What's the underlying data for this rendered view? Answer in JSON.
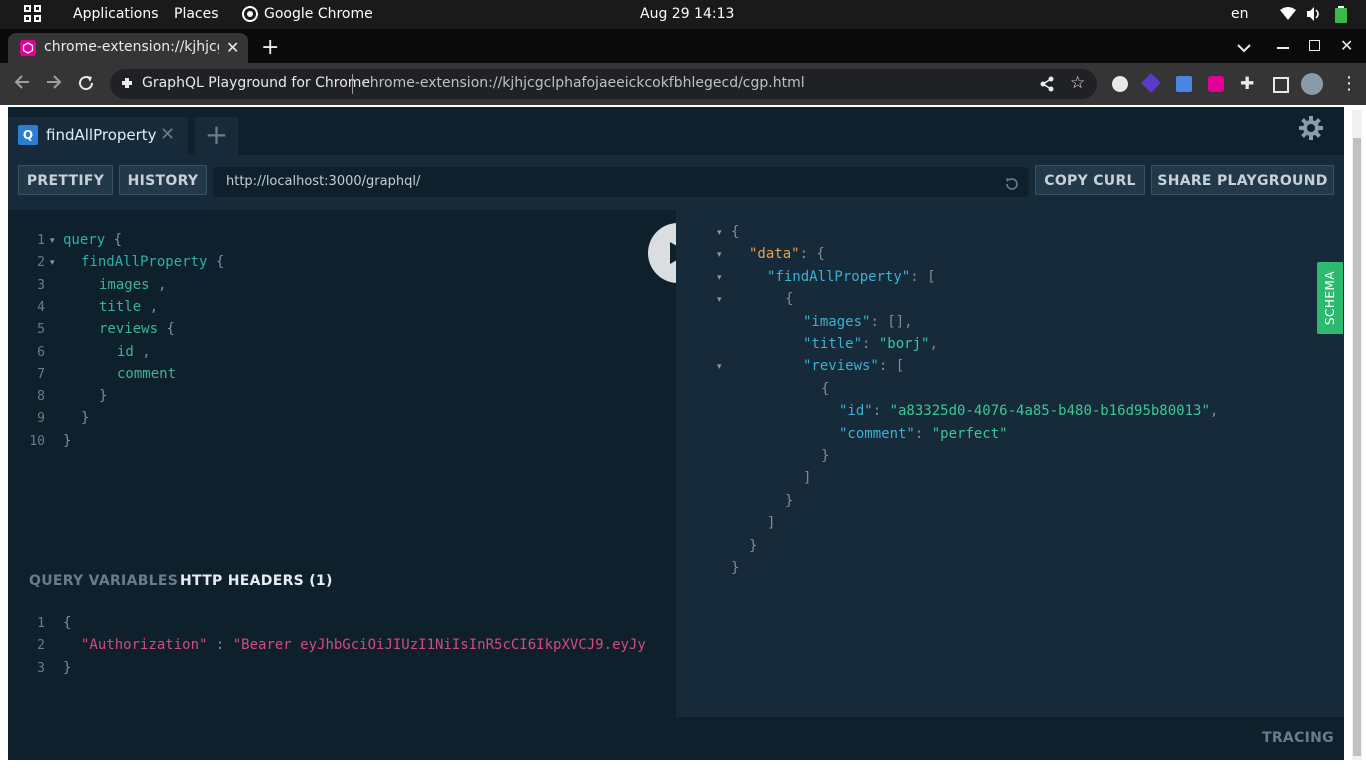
{
  "system_bar": {
    "applications": "Applications",
    "places": "Places",
    "app_name": "Google Chrome",
    "datetime": "Aug 29  14:13",
    "lang": "en"
  },
  "browser": {
    "tab_title": "chrome-extension://kjhjcg",
    "omnibox_site": "GraphQL Playground for Chrome",
    "omnibox_url": "chrome-extension://kjhjcgclphafojaeeickcokfbhlegecd/cgp.html"
  },
  "playground": {
    "tab_badge": "Q",
    "tab_name": "findAllProperty",
    "prettify": "PRETTIFY",
    "history": "HISTORY",
    "endpoint": "http://localhost:3000/graphql/",
    "copy_curl": "COPY CURL",
    "share": "SHARE PLAYGROUND",
    "schema": "SCHEMA",
    "query_variables": "QUERY VARIABLES",
    "http_headers": "HTTP HEADERS (1)",
    "tracing": "TRACING",
    "query_lines": [
      {
        "n": "1",
        "indent": 0,
        "parts": [
          {
            "t": "query",
            "c": "kw"
          },
          {
            "t": " {",
            "c": "pun"
          }
        ]
      },
      {
        "n": "2",
        "indent": 1,
        "parts": [
          {
            "t": "findAllProperty",
            "c": "fld"
          },
          {
            "t": " {",
            "c": "pun"
          }
        ]
      },
      {
        "n": "3",
        "indent": 2,
        "parts": [
          {
            "t": "images",
            "c": "fld2"
          },
          {
            "t": " ,",
            "c": "pun"
          }
        ]
      },
      {
        "n": "4",
        "indent": 2,
        "parts": [
          {
            "t": "title",
            "c": "fld2"
          },
          {
            "t": " ,",
            "c": "pun"
          }
        ]
      },
      {
        "n": "5",
        "indent": 2,
        "parts": [
          {
            "t": "reviews",
            "c": "fld2"
          },
          {
            "t": " {",
            "c": "pun"
          }
        ]
      },
      {
        "n": "6",
        "indent": 3,
        "parts": [
          {
            "t": "id",
            "c": "fld2"
          },
          {
            "t": " ,",
            "c": "pun"
          }
        ]
      },
      {
        "n": "7",
        "indent": 3,
        "parts": [
          {
            "t": "comment",
            "c": "fld2"
          }
        ]
      },
      {
        "n": "8",
        "indent": 2,
        "parts": [
          {
            "t": "}",
            "c": "pun"
          }
        ]
      },
      {
        "n": "9",
        "indent": 1,
        "parts": [
          {
            "t": "}",
            "c": "pun"
          }
        ]
      },
      {
        "n": "10",
        "indent": 0,
        "parts": [
          {
            "t": "}",
            "c": "pun"
          }
        ]
      }
    ],
    "header_lines": [
      {
        "n": "1",
        "indent": 0,
        "parts": [
          {
            "t": "{",
            "c": "pun"
          }
        ]
      },
      {
        "n": "2",
        "indent": 1,
        "parts": [
          {
            "t": "\"Authorization\"",
            "c": "hkey"
          },
          {
            "t": " : ",
            "c": "pun"
          },
          {
            "t": "\"Bearer eyJhbGciOiJIUzI1NiIsInR5cCI6IkpXVCJ9.eyJy",
            "c": "hkey"
          }
        ]
      },
      {
        "n": "3",
        "indent": 0,
        "parts": [
          {
            "t": "}",
            "c": "pun"
          }
        ]
      }
    ],
    "result_lines": [
      {
        "indent": 0,
        "fold": true,
        "parts": [
          {
            "t": "{",
            "c": "pun"
          }
        ]
      },
      {
        "indent": 1,
        "fold": true,
        "parts": [
          {
            "t": "\"data\"",
            "c": "key"
          },
          {
            "t": ": {",
            "c": "pun"
          }
        ]
      },
      {
        "indent": 2,
        "fold": true,
        "parts": [
          {
            "t": "\"findAllProperty\"",
            "c": "rkey"
          },
          {
            "t": ": [",
            "c": "pun"
          }
        ]
      },
      {
        "indent": 3,
        "fold": true,
        "parts": [
          {
            "t": "{",
            "c": "pun"
          }
        ]
      },
      {
        "indent": 4,
        "fold": false,
        "parts": [
          {
            "t": "\"images\"",
            "c": "rkey"
          },
          {
            "t": ": [],",
            "c": "pun"
          }
        ]
      },
      {
        "indent": 4,
        "fold": false,
        "parts": [
          {
            "t": "\"title\"",
            "c": "rkey"
          },
          {
            "t": ": ",
            "c": "pun"
          },
          {
            "t": "\"borj\"",
            "c": "str"
          },
          {
            "t": ",",
            "c": "pun"
          }
        ]
      },
      {
        "indent": 4,
        "fold": true,
        "parts": [
          {
            "t": "\"reviews\"",
            "c": "rkey"
          },
          {
            "t": ": [",
            "c": "pun"
          }
        ]
      },
      {
        "indent": 5,
        "fold": false,
        "parts": [
          {
            "t": "{",
            "c": "pun"
          }
        ]
      },
      {
        "indent": 6,
        "fold": false,
        "parts": [
          {
            "t": "\"id\"",
            "c": "rkey"
          },
          {
            "t": ": ",
            "c": "pun"
          },
          {
            "t": "\"a83325d0-4076-4a85-b480-b16d95b80013\"",
            "c": "str"
          },
          {
            "t": ",",
            "c": "pun"
          }
        ]
      },
      {
        "indent": 6,
        "fold": false,
        "parts": [
          {
            "t": "\"comment\"",
            "c": "rkey"
          },
          {
            "t": ": ",
            "c": "pun"
          },
          {
            "t": "\"perfect\"",
            "c": "str"
          }
        ]
      },
      {
        "indent": 5,
        "fold": false,
        "parts": [
          {
            "t": "}",
            "c": "pun"
          }
        ]
      },
      {
        "indent": 4,
        "fold": false,
        "parts": [
          {
            "t": "]",
            "c": "pun"
          }
        ]
      },
      {
        "indent": 3,
        "fold": false,
        "parts": [
          {
            "t": "}",
            "c": "pun"
          }
        ]
      },
      {
        "indent": 2,
        "fold": false,
        "parts": [
          {
            "t": "]",
            "c": "pun"
          }
        ]
      },
      {
        "indent": 1,
        "fold": false,
        "parts": [
          {
            "t": "}",
            "c": "pun"
          }
        ]
      },
      {
        "indent": 0,
        "fold": false,
        "parts": [
          {
            "t": "}",
            "c": "pun"
          }
        ]
      }
    ]
  },
  "icons": [
    "apps-grid-icon",
    "chrome-icon",
    "wifi-icon",
    "volume-icon",
    "battery-icon",
    "extension-favicon-icon",
    "close-tab-icon",
    "new-tab-icon",
    "back-icon",
    "forward-icon",
    "reload-icon",
    "site-info-icon",
    "share-icon",
    "bookmark-star-icon",
    "settings-gear-icon",
    "play-icon",
    "reset-endpoint-icon"
  ]
}
